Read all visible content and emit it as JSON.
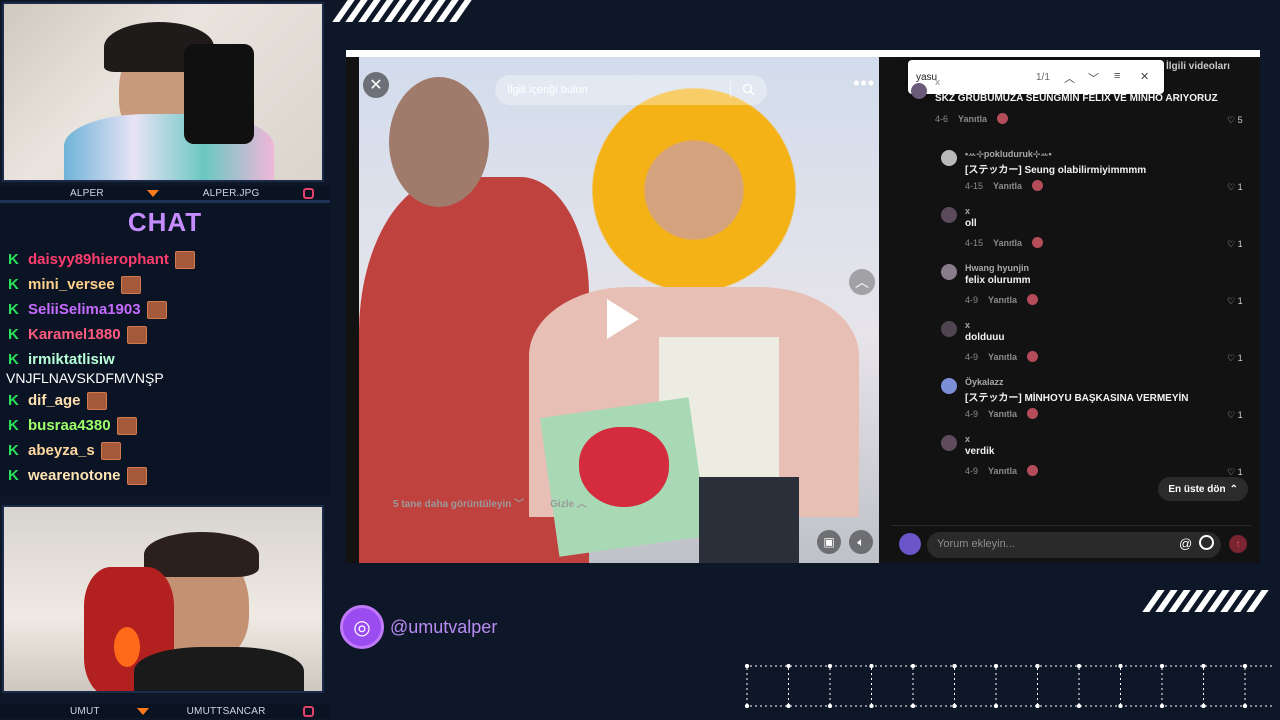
{
  "cams": {
    "top": {
      "left_name": "ALPER",
      "right_name": "ALPER.JPG"
    },
    "bottom": {
      "left_name": "UMUT",
      "right_name": "UMUTTSANCAR"
    }
  },
  "chat": {
    "title": "CHAT",
    "messages": [
      {
        "user": "daisyy89hierophant",
        "color": "#ff3d6e",
        "badge": true
      },
      {
        "user": "mini_versee",
        "color": "#ffd18a",
        "badge": true
      },
      {
        "user": "SeliiSelima1903",
        "color": "#c66bff",
        "badge": true
      },
      {
        "user": "Karamel1880",
        "color": "#ff5b7f",
        "badge": true
      },
      {
        "user": "irmiktatlisiw",
        "color": "#b8ffd9",
        "badge": false,
        "message": "VNJFLNAVSKDFMVNŞP"
      },
      {
        "user": "dif_age",
        "color": "#ffe0b0",
        "badge": true
      },
      {
        "user": "busraa4380",
        "color": "#9cff6a",
        "badge": true
      },
      {
        "user": "abeyza_s",
        "color": "#ffd8a0",
        "badge": true
      },
      {
        "user": "wearenotone",
        "color": "#ffe4b5",
        "badge": true
      }
    ]
  },
  "video": {
    "search_placeholder": "İlgili içeriği bulun"
  },
  "findbar": {
    "query": "yasu",
    "count": "1/1"
  },
  "related_tab": "İlgili videoları",
  "comments": [
    {
      "name": "x",
      "text": "SKZ GRUBUMUZA SEUNGMİN FELİX VE MİNHO ARIYORUZ",
      "date": "4-6",
      "reply": "Yanıtla",
      "likes": "5"
    },
    {
      "name": "•ꕀ⊹pokluduruk⊹ꕀ•",
      "text": "[ステッカー] Seung olabilirmiyimmmm",
      "date": "4-15",
      "reply": "Yanıtla",
      "likes": "1"
    },
    {
      "name": "x",
      "text": "oll",
      "date": "4-15",
      "reply": "Yanıtla",
      "likes": "1"
    },
    {
      "name": "Hwang hyunjin",
      "text": "felix olurumm",
      "date": "4-9",
      "reply": "Yanıtla",
      "likes": "1"
    },
    {
      "name": "x",
      "text": "dolduuu",
      "date": "4-9",
      "reply": "Yanıtla",
      "likes": "1"
    },
    {
      "name": "Öykalazz",
      "text": "[ステッカー] MİNHOYU BAŞKASINA VERMEYİN",
      "date": "4-9",
      "reply": "Yanıtla",
      "likes": "1"
    },
    {
      "name": "x",
      "text": "verdik",
      "date": "4-9",
      "reply": "Yanıtla",
      "likes": "1"
    }
  ],
  "thread": {
    "more": "5 tane daha görüntüleyin",
    "hide": "Gizle"
  },
  "go_top": "En üste dön",
  "comment_input_placeholder": "Yorum ekleyin...",
  "social_handle": "@umutvalper",
  "colors": {
    "accent": "#9a4cf0",
    "chat_title": "#c58cff",
    "k_badge": "#2be35a"
  }
}
